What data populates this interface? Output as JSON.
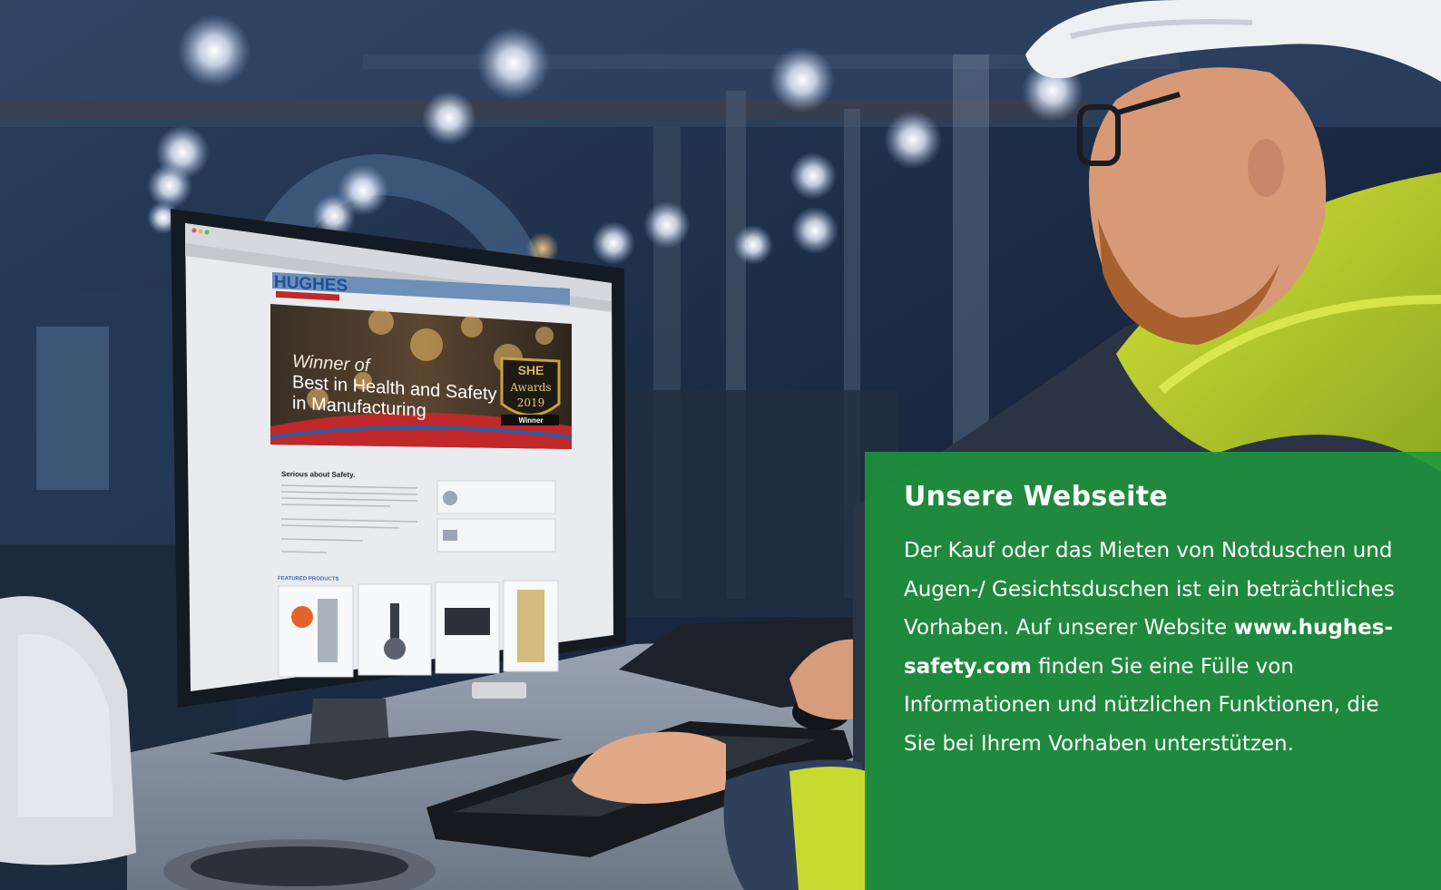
{
  "panel": {
    "title": "Unsere Webseite",
    "body_before": "Der Kauf oder das Mieten von Notduschen und Augen-/ Gesichtsduschen ist ein beträchtliches Vorhaben. Auf unserer Website ",
    "body_link": "www.hughes-safety.com",
    "body_after": " finden Sie eine Fülle von Informationen und nützlichen Funktionen, die Sie bei Ihrem Vorhaben unterstützen."
  },
  "monitor_site": {
    "logo": "HUGHES",
    "banner_line1": "Winner of",
    "banner_line2": "Best in Health and Safety",
    "banner_line3": "in Manufacturing",
    "badge_line1": "SHE",
    "badge_line2": "Awards",
    "badge_line3": "2019",
    "badge_line4": "Winner",
    "section_heading": "Serious about Safety.",
    "featured_heading": "FEATURED PRODUCTS"
  },
  "colors": {
    "panel_green": "#1e963c",
    "banner_red": "#c0282a",
    "logo_blue": "#1f4f9c",
    "badge_gold": "#c9a23a"
  }
}
